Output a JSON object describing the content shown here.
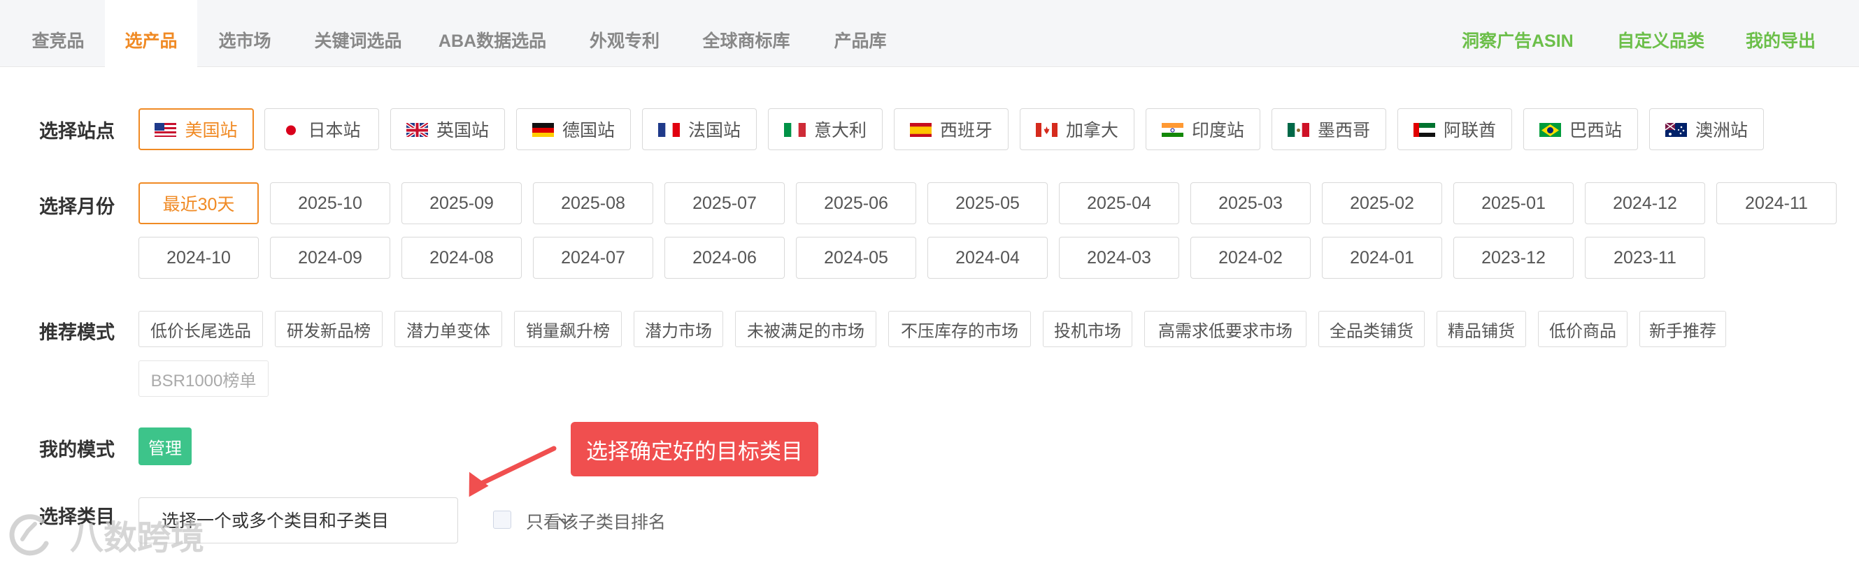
{
  "topnav": {
    "tabs": [
      {
        "label": "查竞品",
        "active": false
      },
      {
        "label": "选产品",
        "active": true
      },
      {
        "label": "选市场",
        "active": false
      },
      {
        "label": "关键词选品",
        "active": false
      },
      {
        "label": "ABA数据选品",
        "active": false
      },
      {
        "label": "外观专利",
        "active": false
      },
      {
        "label": "全球商标库",
        "active": false
      },
      {
        "label": "产品库",
        "active": false
      }
    ],
    "right_links": [
      "洞察广告ASIN",
      "自定义品类",
      "我的导出"
    ]
  },
  "site_row": {
    "label": "选择站点",
    "sites": [
      {
        "label": "美国站",
        "flag": "us-flag",
        "active": true
      },
      {
        "label": "日本站",
        "flag": "jp-flag",
        "active": false
      },
      {
        "label": "英国站",
        "flag": "uk-flag",
        "active": false
      },
      {
        "label": "德国站",
        "flag": "de-flag",
        "active": false
      },
      {
        "label": "法国站",
        "flag": "fr-flag",
        "active": false
      },
      {
        "label": "意大利",
        "flag": "it-flag",
        "active": false
      },
      {
        "label": "西班牙",
        "flag": "es-flag",
        "active": false
      },
      {
        "label": "加拿大",
        "flag": "ca-flag",
        "active": false
      },
      {
        "label": "印度站",
        "flag": "in-flag",
        "active": false
      },
      {
        "label": "墨西哥",
        "flag": "mx-flag",
        "active": false
      },
      {
        "label": "阿联酋",
        "flag": "ae-flag",
        "active": false
      },
      {
        "label": "巴西站",
        "flag": "br-flag",
        "active": false
      },
      {
        "label": "澳洲站",
        "flag": "au-flag",
        "active": false
      }
    ]
  },
  "month_row": {
    "label": "选择月份",
    "months": [
      "最近30天",
      "2025-10",
      "2025-09",
      "2025-08",
      "2025-07",
      "2025-06",
      "2025-05",
      "2025-04",
      "2025-03",
      "2025-02",
      "2025-01",
      "2024-12",
      "2024-11",
      "2024-10",
      "2024-09",
      "2024-08",
      "2024-07",
      "2024-06",
      "2024-05",
      "2024-04",
      "2024-03",
      "2024-02",
      "2024-01",
      "2023-12",
      "2023-11"
    ],
    "active_index": 0
  },
  "mode_row": {
    "label": "推荐模式",
    "modes": [
      "低价长尾选品",
      "研发新品榜",
      "潜力单变体",
      "销量飙升榜",
      "潜力市场",
      "未被满足的市场",
      "不压库存的市场",
      "投机市场",
      "高需求低要求市场",
      "全品类铺货",
      "精品铺货",
      "低价商品",
      "新手推荐",
      "BSR1000榜单"
    ]
  },
  "my_mode": {
    "label": "我的模式",
    "manage_label": "管理"
  },
  "callout": {
    "text": "选择确定好的目标类目"
  },
  "category": {
    "label": "选择类目",
    "placeholder": "选择一个或多个类目和子类目",
    "checkbox_label": "只看该子类目排名",
    "checked": false
  },
  "watermark": {
    "text": "八数跨境"
  },
  "colors": {
    "accent": "#f08a24",
    "green_link": "#6cbf4a",
    "manage": "#3dc48a",
    "callout": "#f04f4f"
  }
}
